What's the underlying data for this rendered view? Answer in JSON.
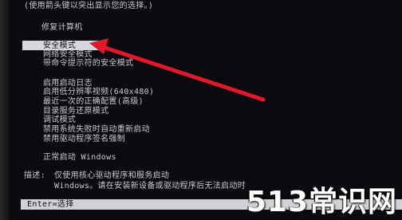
{
  "header": {
    "hint": "(使用箭头键以突出显示您的选择。)"
  },
  "repair": {
    "label": "修复计算机"
  },
  "options": [
    {
      "label": "安全模式"
    },
    {
      "label": "网络安全模式"
    },
    {
      "label": "带命令提示符的安全模式"
    },
    {
      "label": "启用启动日志"
    },
    {
      "label": "启用低分辨率视频(640x480)"
    },
    {
      "label": "最近一次的正确配置(高级)"
    },
    {
      "label": "目录服务还原模式"
    },
    {
      "label": "调试模式"
    },
    {
      "label": "禁用系统失败时自动重新启动"
    },
    {
      "label": "禁用驱动程序签名强制"
    },
    {
      "label": "正常启动 Windows"
    }
  ],
  "description": {
    "label": "描述:",
    "line1": "仅使用核心驱动程序和服务启动",
    "line2": "Windows。请在安装新设备或驱动程序后无法启动时"
  },
  "footer": {
    "text": "Enter=选择"
  },
  "watermark": {
    "text": "513常识网"
  },
  "colors": {
    "background": "#0b0b0f",
    "text": "#c9c9cf",
    "highlight": "#d7d7dc",
    "arrow": "#e0182a"
  }
}
